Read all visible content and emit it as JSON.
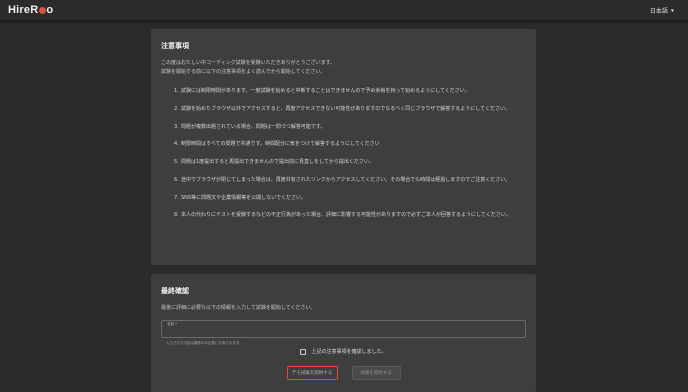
{
  "header": {
    "logo_main": "HireR",
    "logo_tail": "o",
    "language": "日本語"
  },
  "notes": {
    "title": "注意事項",
    "intro": [
      "この度はおたしい中コーディング試験を受験いただきありがとうございます。",
      "試験を開始する前に以下の注意事項をよく読んでから開始してください。"
    ],
    "rules": [
      {
        "num": "1.",
        "text": "試験には制限時間があります。一度試験を始めると中断することはできませんので予め余裕を持って始めるようにしてください。"
      },
      {
        "num": "2.",
        "text": "試験を始めたブラウザ以外でアクセスすると、再度アクセスできない可能性がありますのでなるべく同じブラウザで解答するようにしてください。"
      },
      {
        "num": "3.",
        "text": "問題が複数出題されている場合、問題は一問づつ解答可能です。"
      },
      {
        "num": "4.",
        "text": "制限時間はすべての問題で共通です。時間配分に気をつけて解答するようにしてください"
      },
      {
        "num": "5.",
        "text": "問題は1度提出すると再提出できませんので提出前に見直しをしてから提出ください。"
      },
      {
        "num": "6.",
        "text": "途中でブラウザが閉じてしまった場合は、再度共有されたリンクからアクセスしてください。その場合でも時間は経過しますのでご注意ください。"
      },
      {
        "num": "7.",
        "text": "SNS等に問題文や企業情報等を公開しないでください。"
      },
      {
        "num": "8.",
        "text": "本人の代わりにテストを受験するなどの不正行為があった場合、評価に影響する可能性がありますので必ずご本人が回答するようにしてください。"
      }
    ]
  },
  "final": {
    "title": "最終確認",
    "desc": "最後に評価に必要な以下の情報を入力して試験を開始してください。",
    "name_label": "名前 *",
    "name_value": "",
    "helper": "入力された内容は選考中の企業に共有されます。",
    "confirm_label": "上記の注意事項を確認しました。",
    "demo_button": "デモ試験を開始する",
    "start_button": "試験を開始する"
  },
  "colors": {
    "background": "#2b2b2b",
    "card": "#3e3e3e",
    "accent": "#e5492e"
  }
}
